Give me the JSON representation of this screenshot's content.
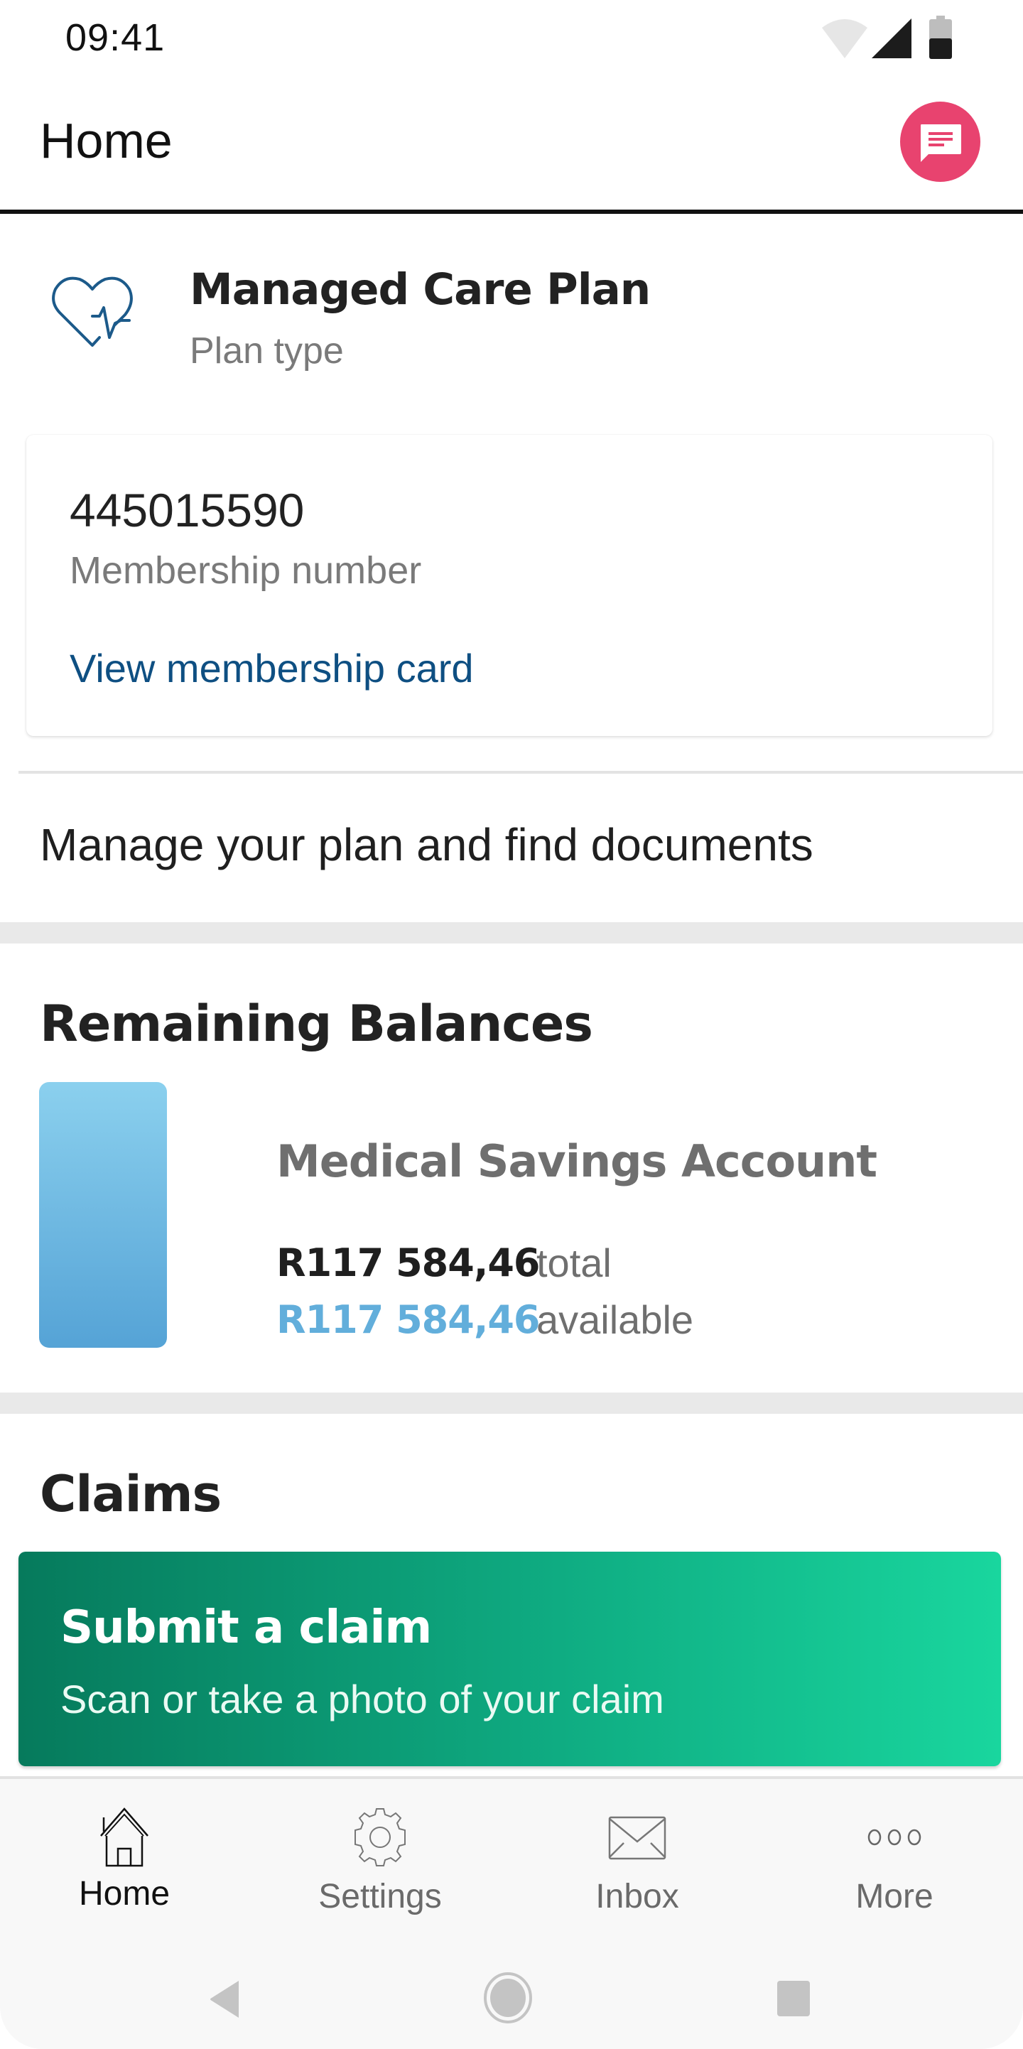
{
  "status_bar": {
    "time": "09:41",
    "icons": [
      "wifi-icon",
      "cellular-signal-icon",
      "battery-icon"
    ]
  },
  "header": {
    "title": "Home",
    "chat_icon": "chat-bubble-icon"
  },
  "plan": {
    "icon": "heart-pulse-icon",
    "name": "Managed Care Plan",
    "type_label": "Plan type"
  },
  "membership": {
    "number": "445015590",
    "label": "Membership number",
    "card_link": "View membership card"
  },
  "manage_link": "Manage your plan and find documents",
  "balances": {
    "title": "Remaining Balances",
    "accounts": [
      {
        "name": "Medical Savings Account",
        "total_amount": "R117 584,46",
        "total_label": "total",
        "available_amount": "R117 584,46",
        "available_label": "available",
        "available_fraction": 1.0
      }
    ]
  },
  "claims": {
    "title": "Claims",
    "submit_title": "Submit a claim",
    "submit_subtitle": "Scan or take a photo of your claim"
  },
  "bottom_nav": {
    "items": [
      {
        "label": "Home",
        "icon": "home-icon",
        "active": true
      },
      {
        "label": "Settings",
        "icon": "gear-icon",
        "active": false
      },
      {
        "label": "Inbox",
        "icon": "envelope-icon",
        "active": false
      },
      {
        "label": "More",
        "icon": "more-dots-icon",
        "active": false
      }
    ]
  },
  "system_nav": [
    "back-icon",
    "home-circle-icon",
    "recents-icon"
  ],
  "colors": {
    "accent_pink": "#e8436f",
    "link_blue": "#0e4f82",
    "available_blue": "#62aedb",
    "claim_green_start": "#067a5c",
    "claim_green_end": "#19d69e"
  }
}
